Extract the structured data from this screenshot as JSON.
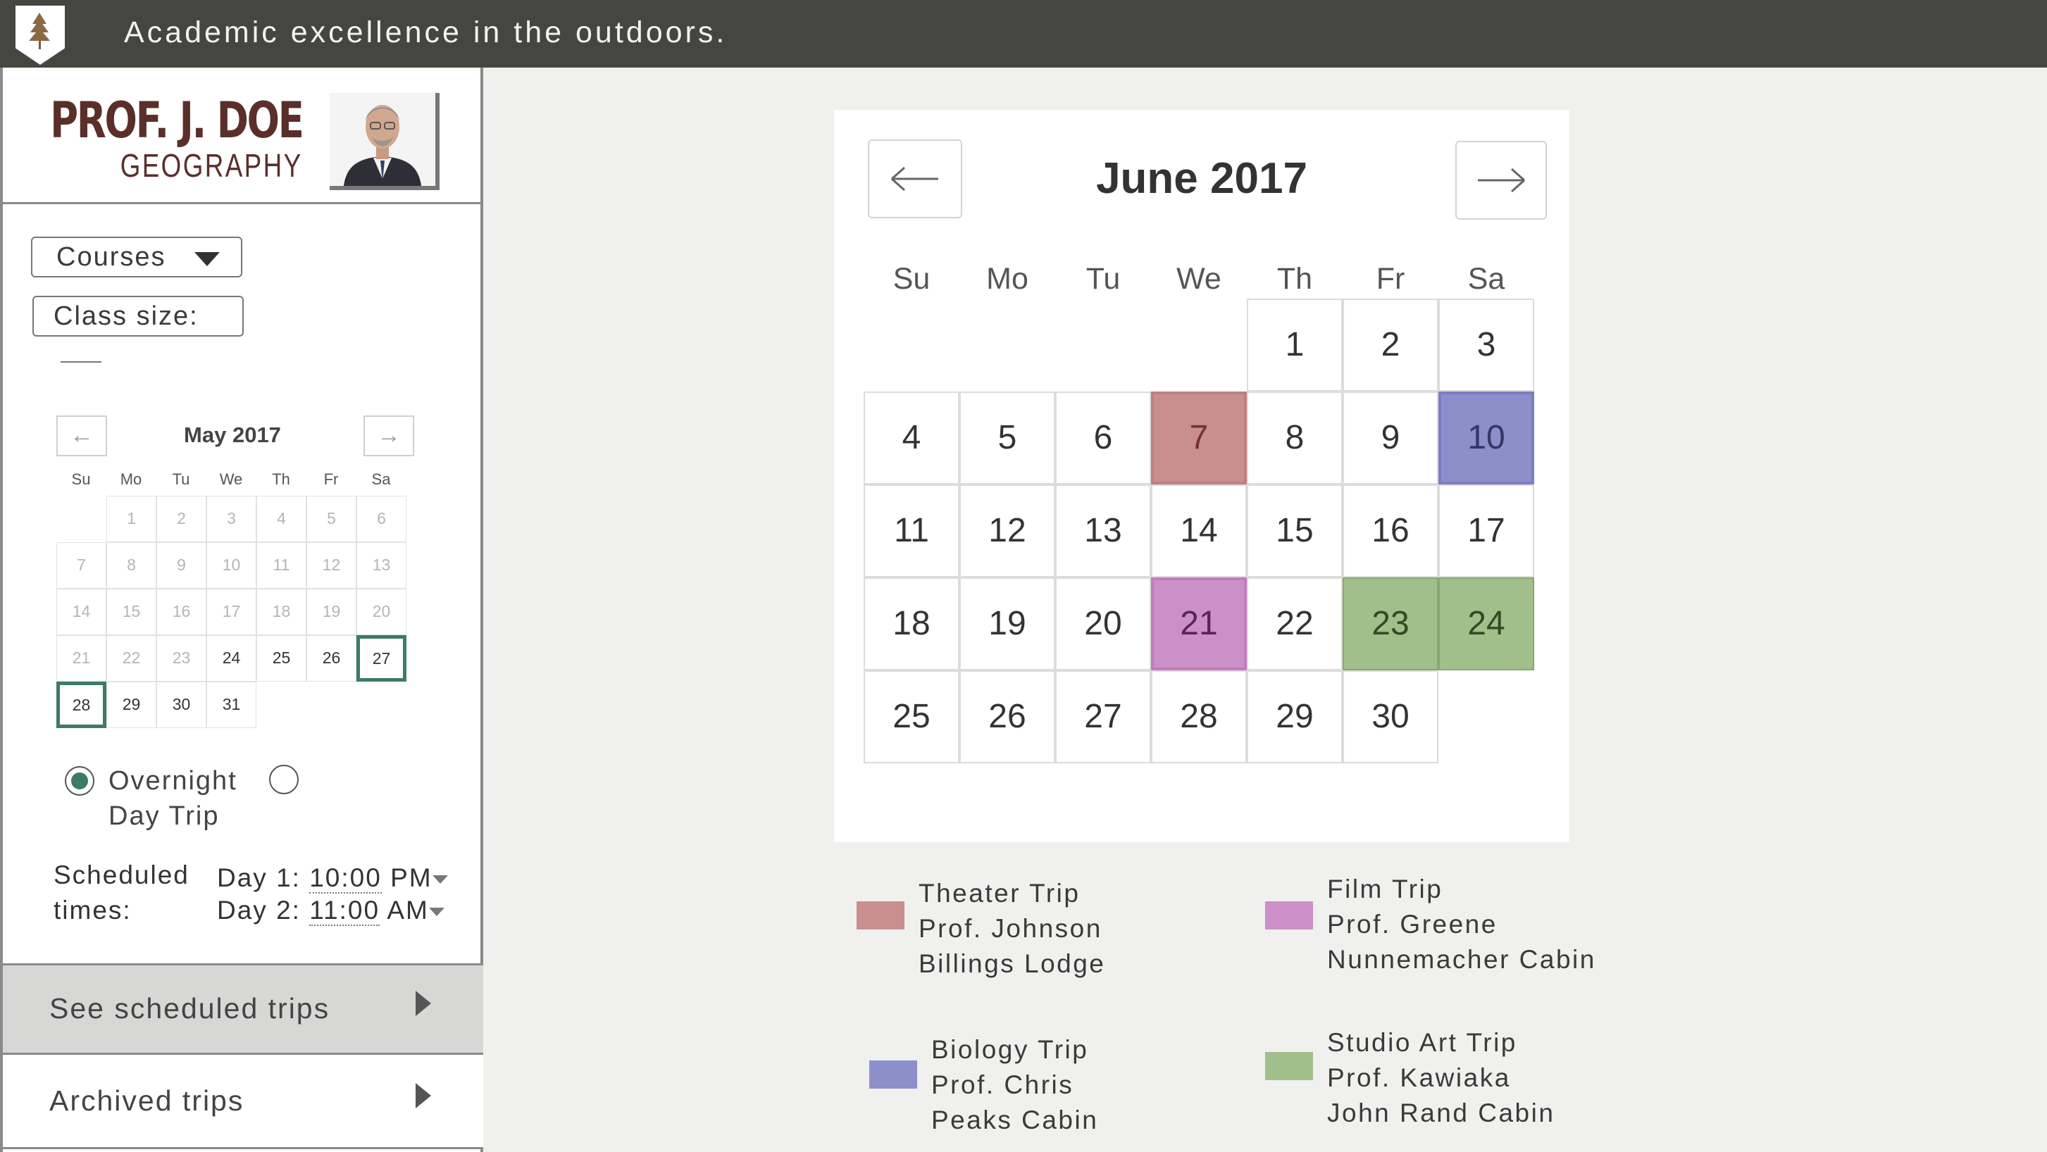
{
  "header": {
    "tagline": "Academic excellence in the outdoors.",
    "logo_icon": "tree-icon"
  },
  "profile": {
    "name": "PROF. J. DOE",
    "department": "GEOGRAPHY",
    "avatar_icon": "avatar"
  },
  "filters": {
    "courses_label": "Courses",
    "class_size_label": "Class size:"
  },
  "mini_calendar": {
    "title": "May 2017",
    "prev_icon": "arrow-left-icon",
    "next_icon": "arrow-right-icon",
    "weekdays": [
      "Su",
      "Mo",
      "Tu",
      "We",
      "Th",
      "Fr",
      "Sa"
    ],
    "rows": [
      [
        "",
        "1",
        "2",
        "3",
        "4",
        "5",
        "6"
      ],
      [
        "7",
        "8",
        "9",
        "10",
        "11",
        "12",
        "13"
      ],
      [
        "14",
        "15",
        "16",
        "17",
        "18",
        "19",
        "20"
      ],
      [
        "21",
        "22",
        "23",
        "24",
        "25",
        "26",
        "27"
      ],
      [
        "28",
        "29",
        "30",
        "31",
        "",
        "",
        ""
      ]
    ],
    "first_active_day": 24,
    "selected_days": [
      27,
      28
    ]
  },
  "trip_type": {
    "option1": "Overnight",
    "option2": "Day Trip",
    "selected": "Overnight"
  },
  "scheduled": {
    "label_line1": "Scheduled",
    "label_line2": "times:",
    "day1_prefix": "Day 1:",
    "day1_time": "10:00",
    "day1_ampm": "PM",
    "day2_prefix": "Day 2:",
    "day2_time": "11:00",
    "day2_ampm": "AM"
  },
  "accordion": {
    "see_scheduled": "See scheduled trips",
    "archived": "Archived trips"
  },
  "calendar": {
    "title": "June 2017",
    "prev_icon": "arrow-left-icon",
    "next_icon": "arrow-right-icon",
    "weekdays": [
      "Su",
      "Mo",
      "Tu",
      "We",
      "Th",
      "Fr",
      "Sa"
    ],
    "rows": [
      [
        "",
        "",
        "",
        "",
        "1",
        "2",
        "3"
      ],
      [
        "4",
        "5",
        "6",
        "7",
        "8",
        "9",
        "10"
      ],
      [
        "11",
        "12",
        "13",
        "14",
        "15",
        "16",
        "17"
      ],
      [
        "18",
        "19",
        "20",
        "21",
        "22",
        "23",
        "24"
      ],
      [
        "25",
        "26",
        "27",
        "28",
        "29",
        "30",
        ""
      ]
    ],
    "highlights": {
      "7": "red",
      "10": "blue",
      "21": "pink",
      "23": "green",
      "24": "green"
    }
  },
  "legend": [
    {
      "color": "#c98f8f",
      "line1": "Theater Trip",
      "line2": "Prof. Johnson",
      "line3": "Billings Lodge"
    },
    {
      "color": "#cc8fc8",
      "line1": "Film Trip",
      "line2": "Prof. Greene",
      "line3": "Nunnemacher Cabin"
    },
    {
      "color": "#8d8fcb",
      "line1": "Biology Trip",
      "line2": "Prof. Chris",
      "line3": "Peaks Cabin"
    },
    {
      "color": "#a0bf8a",
      "line1": "Studio Art Trip",
      "line2": "Prof. Kawiaka",
      "line3": "John Rand Cabin"
    }
  ],
  "colors": {
    "header_bg": "#464641",
    "accent_green": "#3c7a6a",
    "name_color": "#5a2f2a"
  }
}
